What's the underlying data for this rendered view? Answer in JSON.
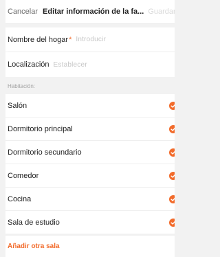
{
  "header": {
    "cancel_label": "Cancelar",
    "title": "Editar información de la fa...",
    "save_label": "Guardar"
  },
  "form": {
    "home_name": {
      "label": "Nombre del hogar",
      "required_mark": "*",
      "placeholder": "Introducir"
    },
    "location": {
      "label": "Localización",
      "placeholder": "Establecer"
    }
  },
  "rooms_section": {
    "header": "Habitación:",
    "rooms": [
      {
        "name": "Salón",
        "selected": true
      },
      {
        "name": "Dormitorio principal",
        "selected": true
      },
      {
        "name": "Dormitorio secundario",
        "selected": true
      },
      {
        "name": "Comedor",
        "selected": true
      },
      {
        "name": "Cocina",
        "selected": true
      },
      {
        "name": "Sala de estudio",
        "selected": true
      }
    ],
    "add_room_label": "Añadir otra sala"
  },
  "colors": {
    "accent": "#f26b2b",
    "placeholder": "#c7c7c7",
    "background": "#f2f2f2"
  }
}
